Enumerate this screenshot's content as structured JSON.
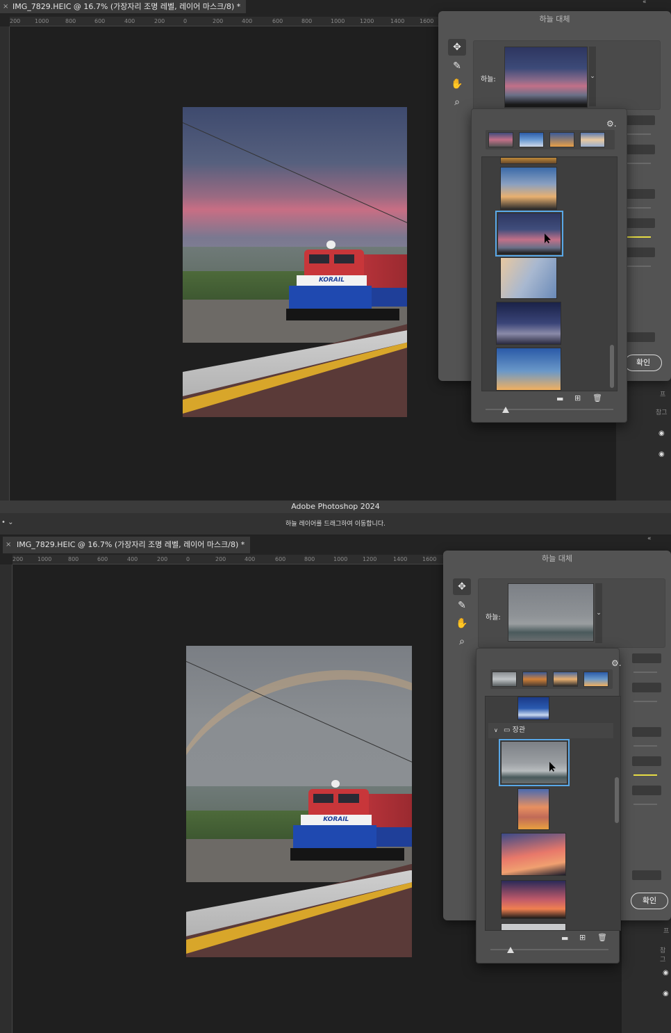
{
  "colors": {
    "accent": "#59a8e8",
    "slider_yellow": "#e7dd45",
    "dialog_bg": "#535353"
  },
  "app": {
    "title": "Adobe Photoshop 2024",
    "hint": "하늘 레이어를 드래그하여 이동합니다."
  },
  "doc": {
    "tab_label": "IMG_7829.HEIC @ 16.7% (가장자리 조명 레벨, 레이어 마스크/8) *",
    "close": "×"
  },
  "ruler": {
    "labels": [
      "200",
      "1000",
      "800",
      "600",
      "400",
      "200",
      "0",
      "200",
      "400",
      "600",
      "800",
      "1000",
      "1200",
      "1400",
      "1600"
    ]
  },
  "dialog": {
    "title": "하늘 대체",
    "sky_label": "하늘:",
    "ok_label": "확인",
    "icons": [
      "move-tool-icon",
      "sky-brush-icon",
      "hand-tool-icon",
      "zoom-tool-icon"
    ]
  },
  "popup": {
    "gear": "⚙.",
    "footer_icons": [
      "folder-icon",
      "new-icon",
      "trash-icon"
    ]
  },
  "panel": {
    "partial_labels": [
      "프",
      "참그"
    ],
    "collapse": "«"
  },
  "screen2": {
    "group_label": "장관",
    "group_icon": "folder-icon"
  },
  "selected_preset_screen1": "pink-dusk",
  "selected_preset_screen2": "rainbow"
}
